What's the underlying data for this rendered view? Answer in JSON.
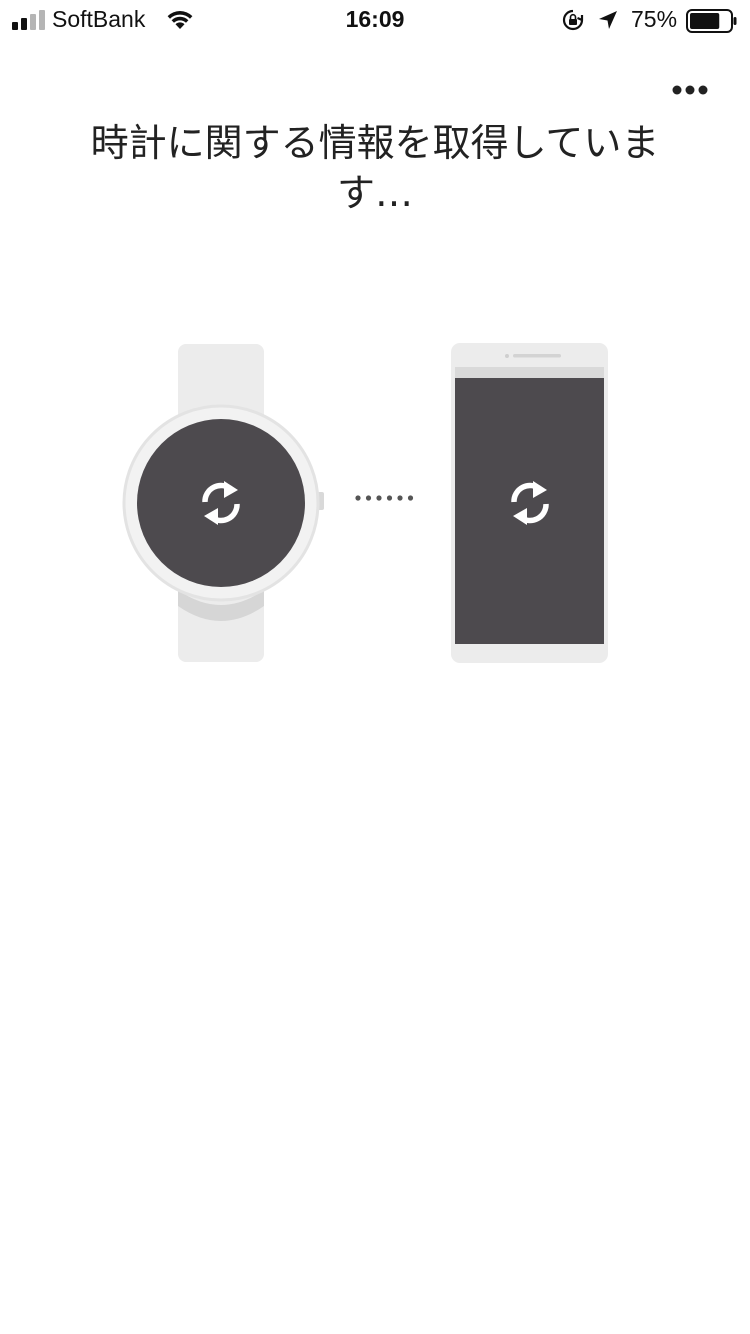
{
  "status_bar": {
    "carrier": "SoftBank",
    "time": "16:09",
    "battery_percent": "75%",
    "battery_level": 0.75,
    "signal_bars_active": 2,
    "signal_bars_total": 4,
    "icons": [
      "wifi-icon",
      "rotation-lock-icon",
      "location-arrow-icon",
      "battery-icon"
    ]
  },
  "header": {
    "menu_icon": "more-dots-icon",
    "title": "時計に関する情報を取得しています…"
  },
  "illustration": {
    "watch_icon": "sync-icon",
    "phone_icon": "sync-icon",
    "connection_icon": "dotted-connection-icon"
  },
  "colors": {
    "screen_dark": "#4d4a4e",
    "device_light": "#ececec",
    "device_border": "#dddddd",
    "dots": "#555555"
  }
}
